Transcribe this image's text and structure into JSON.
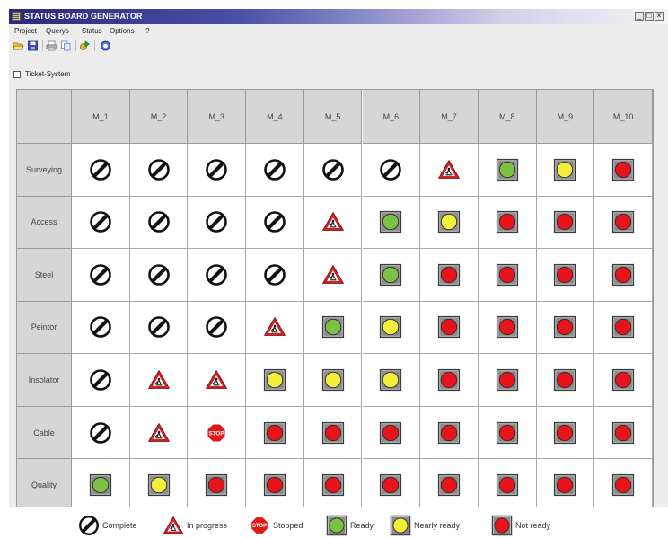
{
  "window": {
    "title": "STATUS BOARD GENERATOR",
    "minimize": "_",
    "maximize": "□",
    "close": "×"
  },
  "menu": [
    "Project",
    "Querys",
    "Status",
    "Options",
    "?"
  ],
  "toolbar": {
    "icons": [
      "folder-open-icon",
      "save-icon",
      "print-icon",
      "copy-icon",
      "refresh-icon",
      "help-icon"
    ]
  },
  "ticket_system": {
    "label": "Ticket-System",
    "checked": false
  },
  "board": {
    "columns": [
      "M_1",
      "M_2",
      "M_3",
      "M_4",
      "M_5",
      "M_6",
      "M_7",
      "M_8",
      "M_9",
      "M_10"
    ],
    "rows": [
      {
        "label": "Surveying",
        "statuses": [
          "complete",
          "complete",
          "complete",
          "complete",
          "complete",
          "complete",
          "in_progress",
          "ready",
          "nearly_ready",
          "not_ready"
        ]
      },
      {
        "label": "Access",
        "statuses": [
          "complete",
          "complete",
          "complete",
          "complete",
          "in_progress",
          "ready",
          "nearly_ready",
          "not_ready",
          "not_ready",
          "not_ready"
        ]
      },
      {
        "label": "Steel",
        "statuses": [
          "complete",
          "complete",
          "complete",
          "complete",
          "in_progress",
          "ready",
          "not_ready",
          "not_ready",
          "not_ready",
          "not_ready"
        ]
      },
      {
        "label": "Peintor",
        "statuses": [
          "complete",
          "complete",
          "complete",
          "in_progress",
          "ready",
          "nearly_ready",
          "not_ready",
          "not_ready",
          "not_ready",
          "not_ready"
        ]
      },
      {
        "label": "Insolator",
        "statuses": [
          "complete",
          "in_progress",
          "in_progress",
          "nearly_ready",
          "nearly_ready",
          "nearly_ready",
          "not_ready",
          "not_ready",
          "not_ready",
          "not_ready"
        ]
      },
      {
        "label": "Cable",
        "statuses": [
          "complete",
          "in_progress",
          "stopped",
          "not_ready",
          "not_ready",
          "not_ready",
          "not_ready",
          "not_ready",
          "not_ready",
          "not_ready"
        ]
      },
      {
        "label": "Quality",
        "statuses": [
          "ready",
          "nearly_ready",
          "not_ready",
          "not_ready",
          "not_ready",
          "not_ready",
          "not_ready",
          "not_ready",
          "not_ready",
          "not_ready"
        ]
      }
    ]
  },
  "legend": [
    {
      "status": "complete",
      "label": "Complete"
    },
    {
      "status": "in_progress",
      "label": "In progress"
    },
    {
      "status": "stopped",
      "label": "Stopped"
    },
    {
      "status": "ready",
      "label": "Ready"
    },
    {
      "status": "nearly_ready",
      "label": "Nearly ready"
    },
    {
      "status": "not_ready",
      "label": "Not ready"
    }
  ],
  "status_icons": {
    "complete": "complete-icon",
    "in_progress": "in-progress-triangle-icon",
    "stopped": "stop-sign-icon",
    "ready": "green-light-icon",
    "nearly_ready": "yellow-light-icon",
    "not_ready": "red-light-icon"
  },
  "stop_sign_text": "STOP",
  "colors": {
    "ready": "#7cc242",
    "nearly_ready": "#f2ee3a",
    "not_ready": "#e8141c",
    "in_progress": "#cc2222",
    "stopped": "#e01818",
    "header_bg": "#d6d6d6"
  }
}
